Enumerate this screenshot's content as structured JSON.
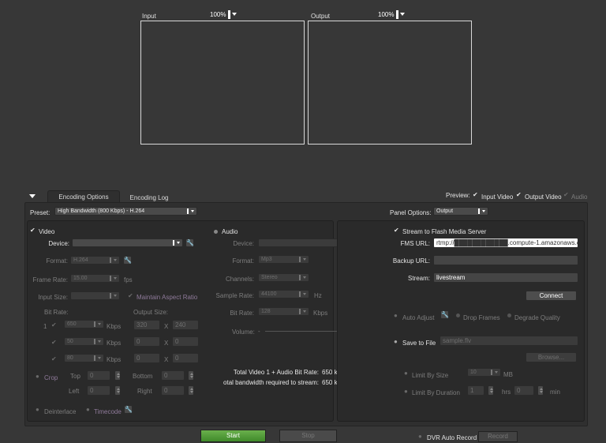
{
  "preview": {
    "input_label": "Input",
    "output_label": "Output",
    "input_zoom": "100%",
    "output_zoom": "100%"
  },
  "tabs": {
    "encoding_options": "Encoding Options",
    "encoding_log": "Encoding Log"
  },
  "preview_opts": {
    "label": "Preview:",
    "input_video": "Input Video",
    "output_video": "Output Video",
    "audio": "Audio"
  },
  "preset": {
    "label": "Preset:",
    "value": "High Bandwidth (800 Kbps) - H.264"
  },
  "panel_options": {
    "label": "Panel Options:",
    "value": "Output"
  },
  "video": {
    "title": "Video",
    "device_label": "Device:",
    "device_value": "",
    "format_label": "Format:",
    "format_value": "H.264",
    "frame_rate_label": "Frame Rate:",
    "frame_rate_value": "15.00",
    "fps": "fps",
    "input_size_label": "Input Size:",
    "input_size_value": "",
    "maintain_aspect": "Maintain Aspect Ratio",
    "bit_rate_label": "Bit Rate:",
    "output_size_label": "Output Size:",
    "rows": [
      {
        "num": "1",
        "rate": "650",
        "unit": "Kbps",
        "w": "320",
        "x": "X",
        "h": "240"
      },
      {
        "num": "",
        "rate": "50",
        "unit": "Kbps",
        "w": "0",
        "x": "X",
        "h": "0"
      },
      {
        "num": "",
        "rate": "80",
        "unit": "Kbps",
        "w": "0",
        "x": "X",
        "h": "0"
      }
    ],
    "crop_label": "Crop",
    "top_label": "Top",
    "top_value": "0",
    "bottom_label": "Bottom",
    "bottom_value": "0",
    "left_label": "Left",
    "left_value": "0",
    "right_label": "Right",
    "right_value": "0",
    "deinterlace": "Deinterlace",
    "timecode": "Timecode"
  },
  "audio": {
    "title": "Audio",
    "device_label": "Device:",
    "device_value": "",
    "format_label": "Format:",
    "format_value": "Mp3",
    "channels_label": "Channels:",
    "channels_value": "Stereo",
    "sample_rate_label": "Sample Rate:",
    "sample_rate_value": "44100",
    "hz": "Hz",
    "bit_rate_label": "Bit Rate:",
    "bit_rate_value": "128",
    "kbps": "Kbps",
    "volume_label": "Volume:",
    "volume_minus": "-",
    "volume_plus": "+",
    "volume_level": 0.72,
    "total_label": "Total Video 1 + Audio Bit Rate:",
    "total_value": "650 kbps",
    "bandwidth_label": "otal bandwidth required to stream:",
    "bandwidth_value": "650 kbps"
  },
  "stream": {
    "title": "Stream to Flash Media Server",
    "fms_label": "FMS URL:",
    "fms_value": "rtmp://████████████.compute-1.amazonaws.com",
    "backup_label": "Backup URL:",
    "backup_value": "",
    "stream_label": "Stream:",
    "stream_value": "livestream",
    "connect": "Connect",
    "auto_adjust": "Auto Adjust",
    "drop_frames": "Drop Frames",
    "degrade_quality": "Degrade Quality",
    "save_to_file": "Save to File",
    "file_value": "sample.flv",
    "browse": "Browse...",
    "limit_size": "Limit By Size",
    "size_value": "10",
    "mb": "MB",
    "limit_duration": "Limit By Duration",
    "hrs_value": "1",
    "hrs": "hrs",
    "min_value": "0",
    "min": "min"
  },
  "bottom": {
    "start": "Start",
    "stop": "Stop",
    "dvr": "DVR Auto Record",
    "record": "Record"
  }
}
